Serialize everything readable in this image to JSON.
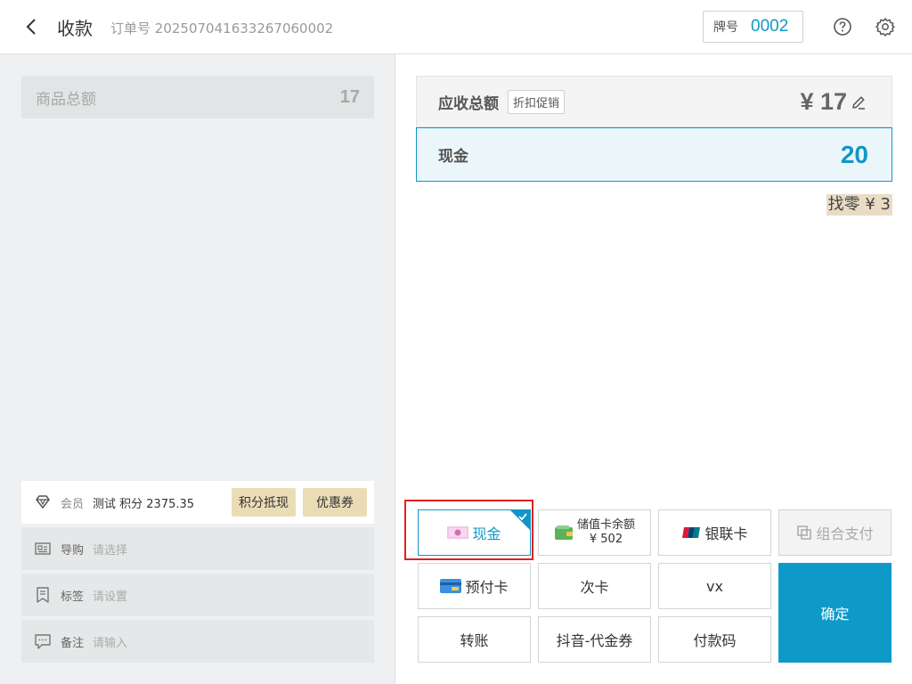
{
  "header": {
    "title": "收款",
    "order_label": "订单号",
    "order_no": "20250704163326706​0002",
    "tag_label": "牌号",
    "tag_value": "0002"
  },
  "left": {
    "goods_total_label": "商品总额",
    "goods_total_value": "17",
    "member": {
      "label": "会员",
      "value": "测试 积分 2375.35",
      "points_button": "积分抵现",
      "coupon_button": "优惠券"
    },
    "guide": {
      "label": "导购",
      "placeholder": "请选择"
    },
    "tags": {
      "label": "标签",
      "placeholder": "请设置"
    },
    "remark": {
      "label": "备注",
      "placeholder": "请输入"
    }
  },
  "right": {
    "due_label": "应收总额",
    "discount_button": "折扣促销",
    "due_amount": "¥ 17",
    "cash_label": "现金",
    "cash_value": "20",
    "change_text": "找零 ¥ 3"
  },
  "payments": {
    "cash": "现金",
    "stored_label": "储值卡余额",
    "stored_balance": "¥ 502",
    "unionpay": "银联卡",
    "combined": "组合支付",
    "prepaid": "预付卡",
    "times_card": "次卡",
    "vx": "vx",
    "transfer": "转账",
    "douyin": "抖音-代金券",
    "pay_code": "付款码",
    "confirm": "确定"
  },
  "colors": {
    "accent": "#1296c7",
    "confirm_bg": "#0e9ac9",
    "member_btn_bg": "#eadcb5",
    "change_bg": "#eadcc4",
    "highlight": "#e02020"
  }
}
